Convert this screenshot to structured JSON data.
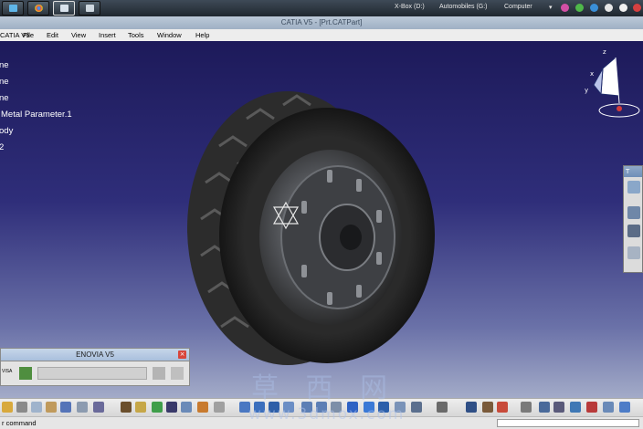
{
  "taskbar": {
    "drives": [
      {
        "label": "X-Box (D:)"
      },
      {
        "label": "Automobiles (G:)"
      },
      {
        "label": "Computer"
      }
    ],
    "tray_arrow": "▾"
  },
  "window": {
    "title": "CATIA V5 - [Prt.CATPart]"
  },
  "menu": {
    "app_label": "CATIA V5",
    "items": [
      "File",
      "Edit",
      "View",
      "Insert",
      "Tools",
      "Window",
      "Help"
    ]
  },
  "tree": {
    "items": [
      "ne",
      "ne",
      "ne",
      "Metal Parameter.1",
      "ody",
      "2"
    ]
  },
  "compass": {
    "labels": [
      "x",
      "y",
      "z"
    ]
  },
  "right_toolbar": {
    "title": "T"
  },
  "enovia": {
    "title": "ENOVIA V5",
    "close_glyph": "×",
    "side_label": "VISA"
  },
  "statusbar": {
    "text": "r command"
  },
  "watermark": {
    "chinese": "草 西 网",
    "url": "www.3dmox.com"
  },
  "colors": {
    "viewport_top": "#1d1a5a",
    "viewport_bottom": "#a3abc8",
    "tire": "#1a1a1a",
    "rim": "#585a5e",
    "titlebar": "#aebdd0"
  }
}
